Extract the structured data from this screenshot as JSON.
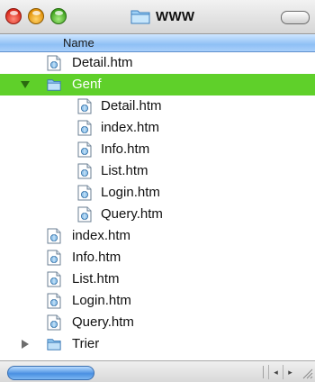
{
  "window": {
    "title": "WWW",
    "title_icon": "folder-icon"
  },
  "header": {
    "name_column": "Name"
  },
  "rows": [
    {
      "label": "Detail.htm",
      "type": "file",
      "level": 1,
      "selected": false
    },
    {
      "label": "Genf",
      "type": "folder",
      "level": 1,
      "expanded": true,
      "selected": true
    },
    {
      "label": "Detail.htm",
      "type": "file",
      "level": 2,
      "selected": false
    },
    {
      "label": "index.htm",
      "type": "file",
      "level": 2,
      "selected": false
    },
    {
      "label": "Info.htm",
      "type": "file",
      "level": 2,
      "selected": false
    },
    {
      "label": "List.htm",
      "type": "file",
      "level": 2,
      "selected": false
    },
    {
      "label": "Login.htm",
      "type": "file",
      "level": 2,
      "selected": false
    },
    {
      "label": "Query.htm",
      "type": "file",
      "level": 2,
      "selected": false
    },
    {
      "label": "index.htm",
      "type": "file",
      "level": 1,
      "selected": false
    },
    {
      "label": "Info.htm",
      "type": "file",
      "level": 1,
      "selected": false
    },
    {
      "label": "List.htm",
      "type": "file",
      "level": 1,
      "selected": false
    },
    {
      "label": "Login.htm",
      "type": "file",
      "level": 1,
      "selected": false
    },
    {
      "label": "Query.htm",
      "type": "file",
      "level": 1,
      "selected": false
    },
    {
      "label": "Trier",
      "type": "folder",
      "level": 1,
      "expanded": false,
      "selected": false
    }
  ],
  "colors": {
    "selection": "#5fd02a",
    "header": "#8fc0f5"
  },
  "scrollbar": {
    "left_arrow": "◂",
    "right_arrow": "▸"
  }
}
